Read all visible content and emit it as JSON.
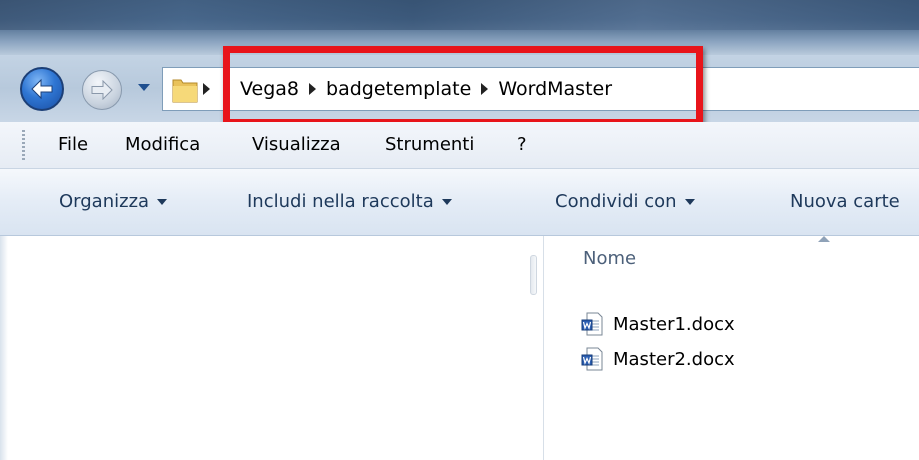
{
  "address": {
    "crumbs": [
      "Vega8",
      "badgetemplate",
      "WordMaster"
    ]
  },
  "menu": [
    "File",
    "Modifica",
    "Visualizza",
    "Strumenti",
    "?"
  ],
  "commands": {
    "organize": "Organizza",
    "include": "Includi nella raccolta",
    "share": "Condividi con",
    "new_folder": "Nuova carte"
  },
  "file_list": {
    "column_name": "Nome",
    "files": [
      {
        "name": "Master1.docx",
        "icon": "word-document-icon"
      },
      {
        "name": "Master2.docx",
        "icon": "word-document-icon"
      }
    ]
  },
  "colors": {
    "highlight": "#e8141a",
    "command_text": "#1e395b"
  }
}
